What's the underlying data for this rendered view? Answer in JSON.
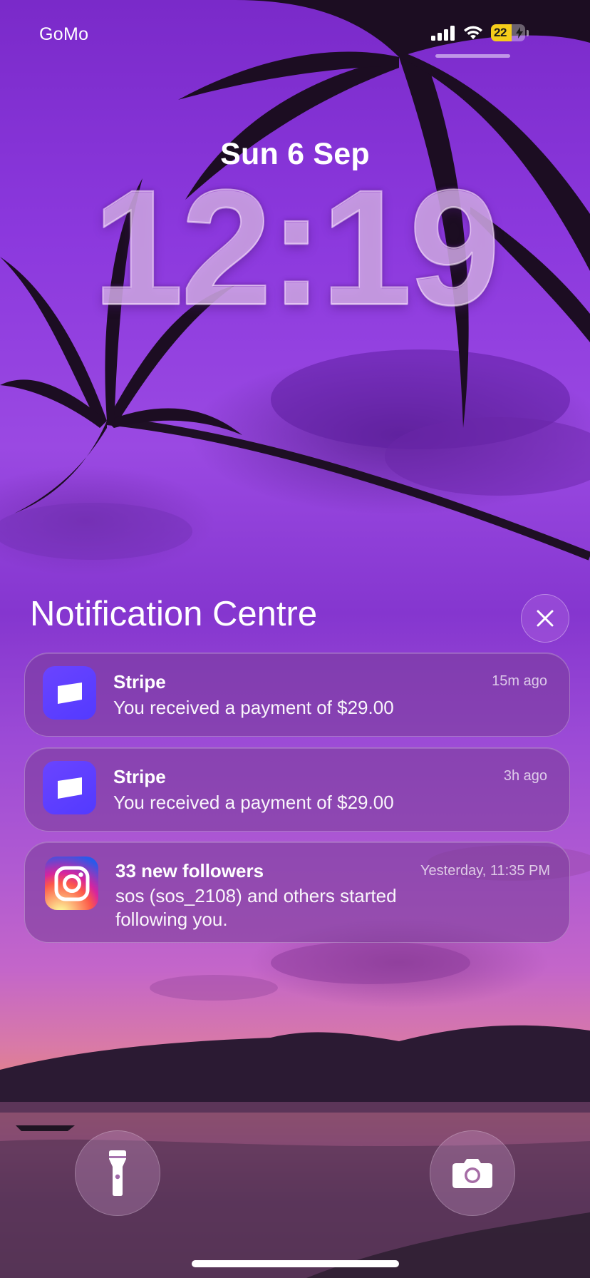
{
  "status_bar": {
    "carrier": "GoMo",
    "battery_level": "22",
    "signal_icon": "cellular-signal-icon",
    "wifi_icon": "wifi-icon",
    "battery_icon": "battery-charging-icon"
  },
  "lock_screen": {
    "date": "Sun 6 Sep",
    "time": "12:19"
  },
  "notification_centre": {
    "title": "Notification Centre",
    "close_icon": "close-icon",
    "notifications": [
      {
        "app": "Stripe",
        "icon": "stripe-icon",
        "title": "Stripe",
        "body": "You received a payment of $29.00",
        "time": "15m ago"
      },
      {
        "app": "Stripe",
        "icon": "stripe-icon",
        "title": "Stripe",
        "body": "You received a payment of $29.00",
        "time": "3h ago"
      },
      {
        "app": "Instagram",
        "icon": "instagram-icon",
        "title": "33 new followers",
        "body": "sos (sos_2108) and others started following you.",
        "time": "Yesterday, 11:35 PM"
      }
    ]
  },
  "bottom_controls": {
    "left_icon": "flashlight-icon",
    "right_icon": "camera-icon"
  },
  "colors": {
    "stripe_brand": "#533aff",
    "battery_fill": "#f5cd1a"
  }
}
